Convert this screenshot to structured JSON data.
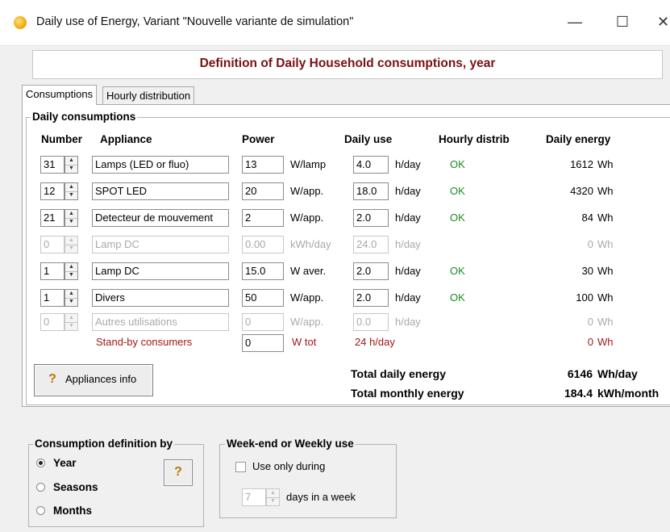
{
  "window": {
    "title": "Daily use of Energy, Variant  \"Nouvelle variante de simulation\"",
    "minimize_glyph": "—",
    "maximize_glyph": "☐",
    "close_glyph": "✕"
  },
  "header": {
    "title": "Definition of Daily Household consumptions, year"
  },
  "tabs": [
    {
      "label": "Consumptions",
      "active": true
    },
    {
      "label": "Hourly distribution",
      "active": false
    }
  ],
  "daily": {
    "group_label": "Daily consumptions",
    "columns": {
      "number": "Number",
      "appliance": "Appliance",
      "power": "Power",
      "daily_use": "Daily use",
      "hourly": "Hourly distrib",
      "energy": "Daily energy"
    },
    "rows": [
      {
        "number": "31",
        "appliance": "Lamps (LED or fluo)",
        "power": "13",
        "power_unit": "W/lamp",
        "use": "4.0",
        "use_unit": "h/day",
        "status": "OK",
        "energy": "1612",
        "energy_unit": "Wh",
        "enabled": true
      },
      {
        "number": "12",
        "appliance": "SPOT LED",
        "power": "20",
        "power_unit": "W/app.",
        "use": "18.0",
        "use_unit": "h/day",
        "status": "OK",
        "energy": "4320",
        "energy_unit": "Wh",
        "enabled": true
      },
      {
        "number": "21",
        "appliance": "Detecteur de mouvement",
        "power": "2",
        "power_unit": "W/app.",
        "use": "2.0",
        "use_unit": "h/day",
        "status": "OK",
        "energy": "84",
        "energy_unit": "Wh",
        "enabled": true
      },
      {
        "number": "0",
        "appliance": "Lamp DC",
        "power": "0.00",
        "power_unit": "kWh/day",
        "use": "24.0",
        "use_unit": "h/day",
        "status": "",
        "energy": "0",
        "energy_unit": "Wh",
        "enabled": false
      },
      {
        "number": "1",
        "appliance": "Lamp DC",
        "power": "15.0",
        "power_unit": "W aver.",
        "use": "2.0",
        "use_unit": "h/day",
        "status": "OK",
        "energy": "30",
        "energy_unit": "Wh",
        "enabled": true
      },
      {
        "number": "1",
        "appliance": "Divers",
        "power": "50",
        "power_unit": "W/app.",
        "use": "2.0",
        "use_unit": "h/day",
        "status": "OK",
        "energy": "100",
        "energy_unit": "Wh",
        "enabled": true
      },
      {
        "number": "0",
        "appliance": "Autres utilisations",
        "power": "0",
        "power_unit": "W/app.",
        "use": "0.0",
        "use_unit": "h/day",
        "status": "",
        "energy": "0",
        "energy_unit": "Wh",
        "enabled": false
      }
    ],
    "standby": {
      "label": "Stand-by consumers",
      "power": "0",
      "power_unit": "W tot",
      "use_text": "24 h/day",
      "energy": "0",
      "energy_unit": "Wh"
    },
    "appliances_info_label": "Appliances info",
    "total_daily_label": "Total daily energy",
    "total_daily_value": "6146",
    "total_daily_unit": "Wh/day",
    "total_monthly_label": "Total monthly energy",
    "total_monthly_value": "184.4",
    "total_monthly_unit": "kWh/month"
  },
  "consumption_definition": {
    "group_label": "Consumption definition by",
    "options": [
      {
        "label": "Year",
        "checked": true
      },
      {
        "label": "Seasons",
        "checked": false
      },
      {
        "label": "Months",
        "checked": false
      }
    ],
    "help_glyph": "?"
  },
  "weekend": {
    "group_label": "Week-end or Weekly use",
    "checkbox_label": "Use only during",
    "checked": false,
    "days_value": "7",
    "days_label": "days in a week"
  }
}
